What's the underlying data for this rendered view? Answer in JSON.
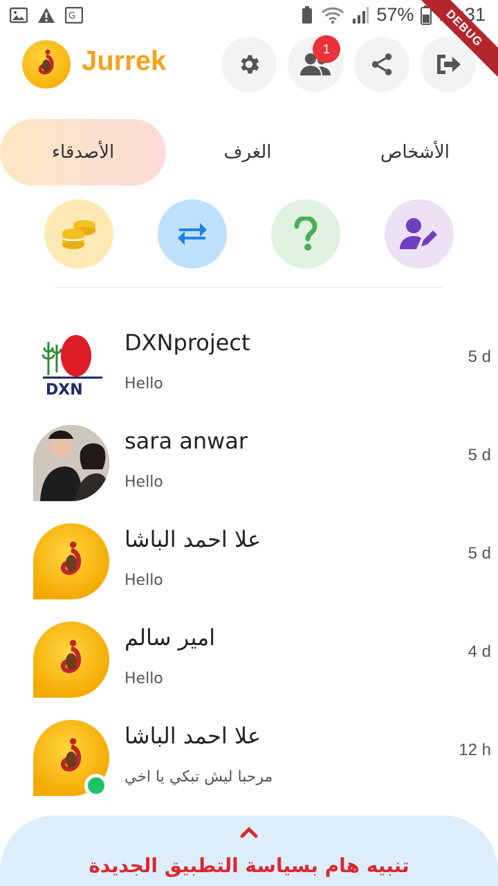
{
  "status_bar": {
    "battery": "57%",
    "time": "12:31",
    "debug_label": "DEBUG"
  },
  "header": {
    "brand": "Jurrek",
    "notification_count": "1",
    "buttons": [
      "settings",
      "friend-requests",
      "share",
      "logout"
    ]
  },
  "tabs": [
    {
      "label": "الأصدقاء",
      "active": true
    },
    {
      "label": "الغرف",
      "active": false
    },
    {
      "label": "الأشخاص",
      "active": false
    }
  ],
  "quick_actions": [
    {
      "icon": "coins-icon",
      "bg": "#fde9b3"
    },
    {
      "icon": "swap-icon",
      "bg": "#bfe0fb"
    },
    {
      "icon": "question-icon",
      "bg": "#dff1df"
    },
    {
      "icon": "edit-user-icon",
      "bg": "#ece1f5"
    }
  ],
  "chats": [
    {
      "name": "DXNproject",
      "preview": "Hello",
      "time": "5 d",
      "avatar": "dxn"
    },
    {
      "name": "sara anwar",
      "preview": "Hello",
      "time": "5 d",
      "avatar": "photo"
    },
    {
      "name": "علا احمد الباشا",
      "preview": "Hello",
      "time": "5 d",
      "avatar": "logo"
    },
    {
      "name": "امير سالم",
      "preview": "Hello",
      "time": "4 d",
      "avatar": "logo"
    },
    {
      "name": "علا احمد الباشا",
      "preview": "مرحبا ليش تبكي يا اخي",
      "time": "12 h",
      "avatar": "logo",
      "online": true
    }
  ],
  "policy": {
    "text": "تنبيه هام بسياسة التطبيق الجديدة"
  },
  "colors": {
    "brand": "#f4a21c",
    "badge": "#e8333a",
    "online": "#1ec468",
    "policy_text": "#d9282f"
  }
}
